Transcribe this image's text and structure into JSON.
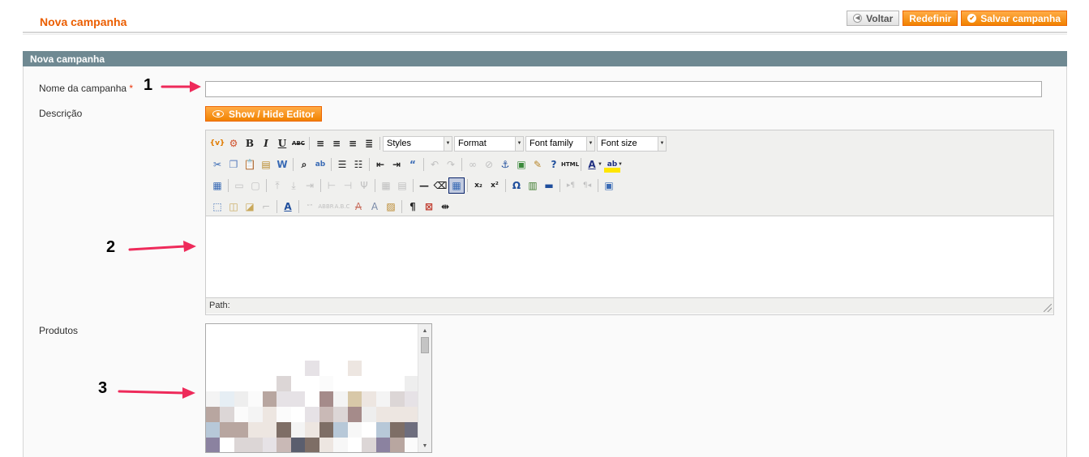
{
  "header": {
    "title": "Nova campanha",
    "back_label": "Voltar",
    "reset_label": "Redefinir",
    "save_label": "Salvar campanha"
  },
  "fieldset": {
    "title": "Nova campanha"
  },
  "form": {
    "name_label": "Nome da campanha",
    "required_mark": "*",
    "name_value": "",
    "description_label": "Descrição",
    "editor_toggle_label": "Show / Hide Editor",
    "products_label": "Produtos"
  },
  "editor": {
    "styles_select": "Styles",
    "format_select": "Format",
    "font_family_select": "Font family",
    "font_size_select": "Font size",
    "path_label": "Path:"
  },
  "annotations": [
    "1",
    "2",
    "3"
  ],
  "colors": {
    "accent": "#eb5e00",
    "button_orange": "#f18200",
    "fieldset_header": "#6f8992"
  }
}
